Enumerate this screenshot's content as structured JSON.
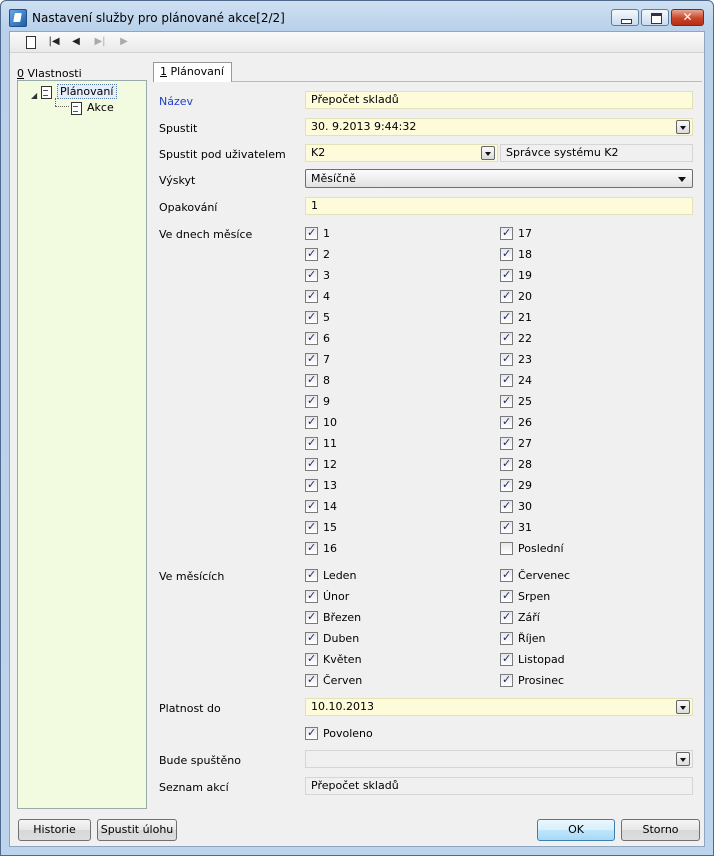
{
  "window": {
    "title": "Nastavení služby pro plánované akce[2/2]"
  },
  "toolbar": {
    "buttons": [
      {
        "name": "new",
        "icon": "new-document-icon"
      },
      {
        "name": "first",
        "icon": "first-record-icon"
      },
      {
        "name": "prev",
        "icon": "previous-record-icon"
      },
      {
        "name": "next",
        "icon": "next-record-icon"
      },
      {
        "name": "last",
        "icon": "last-record-icon"
      }
    ]
  },
  "left_panel": {
    "tab_key": "0",
    "tab_label": " Vlastnosti",
    "tree": [
      {
        "label": "Plánovaní"
      },
      {
        "label": "Akce"
      }
    ]
  },
  "tabs": [
    {
      "key": "1",
      "label": " Plánovaní"
    }
  ],
  "form": {
    "nazev": {
      "label": "Název",
      "value": "Přepočet skladů"
    },
    "spustit": {
      "label": "Spustit",
      "value": "30. 9.2013  9:44:32"
    },
    "uzivatel": {
      "label": "Spustit pod uživatelem",
      "value": "K2",
      "name_value": "Správce systému K2"
    },
    "vyskyt": {
      "label": "Výskyt",
      "value": "Měsíčně"
    },
    "opakovani": {
      "label": "Opakování",
      "value": "1"
    },
    "dny": {
      "label": "Ve dnech měsíce",
      "col1": [
        "1",
        "2",
        "3",
        "4",
        "5",
        "6",
        "7",
        "8",
        "9",
        "10",
        "11",
        "12",
        "13",
        "14",
        "15",
        "16"
      ],
      "col2": [
        "17",
        "18",
        "19",
        "20",
        "21",
        "22",
        "23",
        "24",
        "25",
        "26",
        "27",
        "28",
        "29",
        "30",
        "31",
        "Poslední"
      ],
      "col2_checked": [
        true,
        true,
        true,
        true,
        true,
        true,
        true,
        true,
        true,
        true,
        true,
        true,
        true,
        true,
        true,
        false
      ]
    },
    "mesice": {
      "label": "Ve měsících",
      "col1": [
        "Leden",
        "Únor",
        "Březen",
        "Duben",
        "Květen",
        "Červen"
      ],
      "col2": [
        "Červenec",
        "Srpen",
        "Září",
        "Říjen",
        "Listopad",
        "Prosinec"
      ]
    },
    "platnost": {
      "label": "Platnost do",
      "value": "10.10.2013"
    },
    "povoleno": {
      "label": "Povoleno",
      "checked": true
    },
    "bude": {
      "label": "Bude spuštěno",
      "value": " .  .      :  :"
    },
    "seznam": {
      "label": "Seznam akcí",
      "value": "Přepočet skladů"
    }
  },
  "buttons": {
    "historie": "Historie",
    "spustit_ulohu": "Spustit úlohu",
    "ok": "OK",
    "storno": "Storno"
  },
  "colors": {
    "required_label": "#1f3fc7",
    "editable_field": "#fdfbd9",
    "tree_background": "#f2fae0"
  }
}
